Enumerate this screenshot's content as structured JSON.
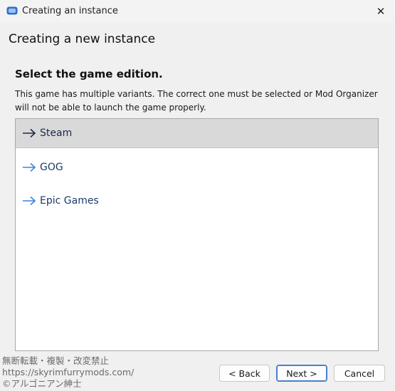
{
  "window": {
    "title": "Creating an instance",
    "close_glyph": "✕"
  },
  "page": {
    "heading": "Creating a new instance",
    "section_heading": "Select the game edition.",
    "description": "This game has multiple variants. The correct one must be selected or Mod Organizer will not be able to launch the game properly."
  },
  "editions": [
    {
      "label": "Steam",
      "icon": "arrow-right-icon",
      "selected": true
    },
    {
      "label": "GOG",
      "icon": "arrow-right-icon",
      "selected": false
    },
    {
      "label": "Epic Games",
      "icon": "arrow-right-icon",
      "selected": false
    }
  ],
  "buttons": {
    "back": "< Back",
    "next": "Next >",
    "cancel": "Cancel"
  },
  "watermark": {
    "line1": "無断転載・複製・改変禁止",
    "line2": "https://skyrimfurrymods.com/",
    "line3": "©アルゴニアン紳士"
  },
  "colors": {
    "accent": "#4a7fcf",
    "arrow": "#3a86d6",
    "selected_row": "#d9d9d9"
  }
}
